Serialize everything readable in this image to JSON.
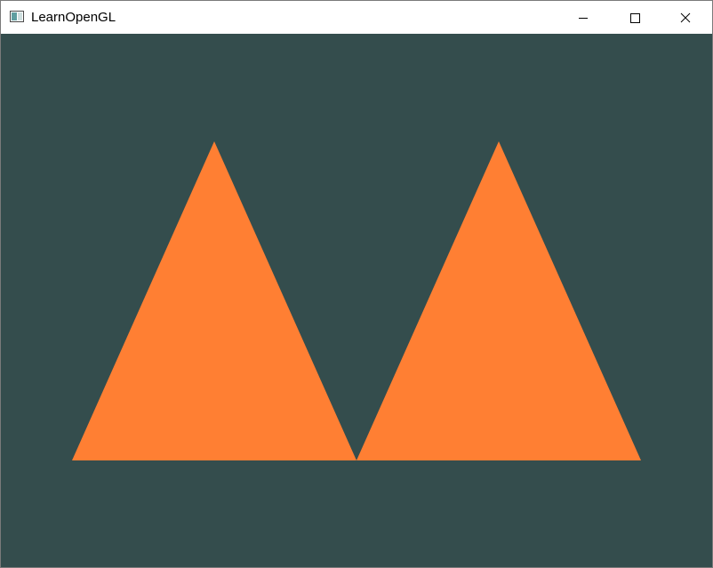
{
  "window": {
    "title": "LearnOpenGL"
  },
  "icons": {
    "app": "app-window-icon",
    "minimize": "minimize-icon",
    "maximize": "maximize-icon",
    "close": "close-icon"
  },
  "colors": {
    "clear_color": "#344d4d",
    "triangle_fill": "#ff7f33"
  },
  "scene": {
    "primitive": "triangle",
    "count": 2
  }
}
